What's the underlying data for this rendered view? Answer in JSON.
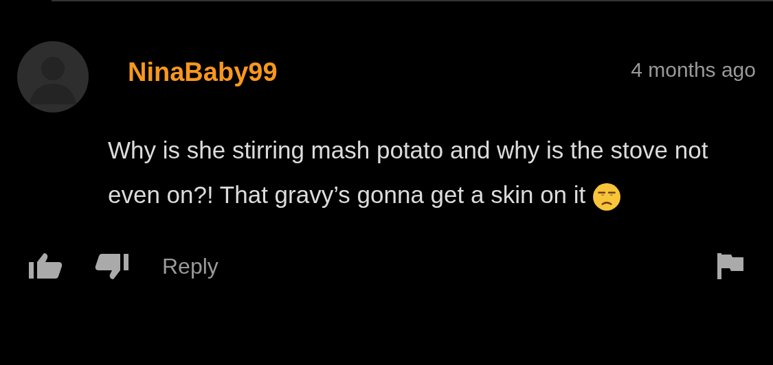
{
  "comment": {
    "author": "NinaBaby99",
    "time": "4 months ago",
    "text": "Why is she stirring mash potato and why is the stove not even on?! That gravy’s gonna get a skin on it",
    "actions": {
      "reply": "Reply"
    }
  }
}
